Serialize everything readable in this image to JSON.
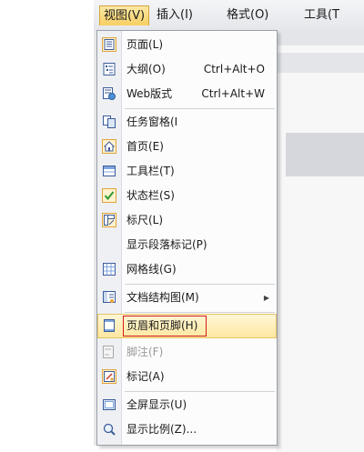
{
  "menubar": {
    "items": [
      {
        "label": "视图(V)",
        "active": true
      },
      {
        "label": "插入(I)"
      },
      {
        "label": "格式(O)"
      },
      {
        "label": "工具(T"
      }
    ]
  },
  "menu": {
    "items": [
      {
        "label": "页面(L)",
        "icon": "page-icon",
        "checked": true
      },
      {
        "label": "大纲(O)",
        "shortcut": "Ctrl+Alt+O",
        "icon": "outline-icon"
      },
      {
        "label": "Web版式",
        "shortcut": "Ctrl+Alt+W",
        "icon": "web-layout-icon"
      },
      {
        "label": "任务窗格(I",
        "icon": "task-pane-icon"
      },
      {
        "label": "首页(E)",
        "icon": "home-icon",
        "checked": true
      },
      {
        "label": "工具栏(T)",
        "icon": "toolbar-icon"
      },
      {
        "label": "状态栏(S)",
        "icon": "checkmark-icon",
        "checked": true
      },
      {
        "label": "标尺(L)",
        "icon": "ruler-icon",
        "checked": true
      },
      {
        "label": "显示段落标记(P)"
      },
      {
        "label": "网格线(G)",
        "icon": "grid-icon"
      },
      {
        "label": "文档结构图(M)",
        "icon": "document-map-icon",
        "submenu": true
      },
      {
        "label": "页眉和页脚(H)",
        "icon": "header-footer-icon",
        "highlighted": true
      },
      {
        "label": "脚注(F)",
        "icon": "footnote-icon",
        "disabled": true
      },
      {
        "label": "标记(A)",
        "icon": "markup-icon",
        "checked": true
      },
      {
        "label": "全屏显示(U)",
        "icon": "fullscreen-icon"
      },
      {
        "label": "显示比例(Z)...",
        "icon": "zoom-icon"
      }
    ]
  },
  "colors": {
    "highlight": "#fde8a1",
    "highlight_border": "#e5c365",
    "red_annotation": "#d11a1a",
    "menu_bg": "#fcfcfd"
  }
}
